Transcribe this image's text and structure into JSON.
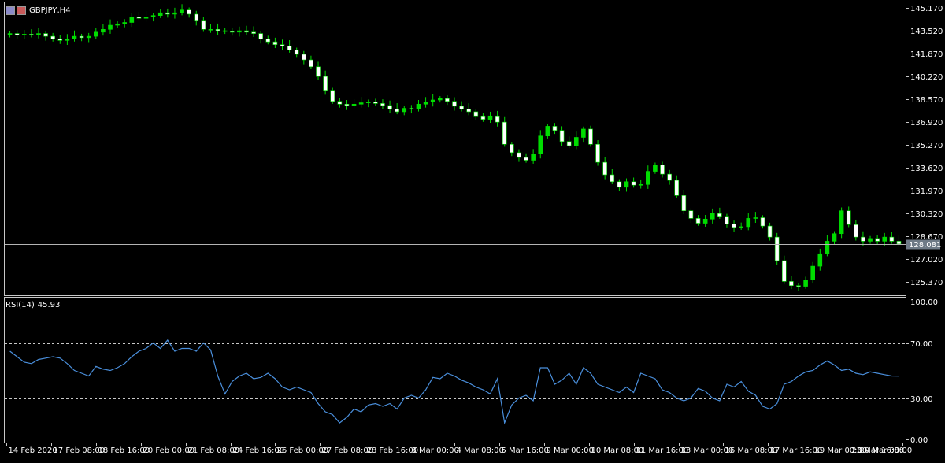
{
  "symbol": {
    "pair": "GBPJPY",
    "timeframe": "H4",
    "title": "GBPJPY,H4"
  },
  "icons": [
    "window-icon",
    "flag-icon"
  ],
  "colors": {
    "background": "#000000",
    "bull": "#00dd00",
    "bear": "#ffffff",
    "frame": "#c8c8c8",
    "rsi_line": "#4a8fdc",
    "current_price_tag": "#6e7a86"
  },
  "current_price": {
    "value": 128.081,
    "label": "128.081"
  },
  "price_axis": {
    "ticks": [
      "145.170",
      "143.520",
      "141.870",
      "140.220",
      "138.570",
      "136.920",
      "135.270",
      "133.620",
      "131.970",
      "130.320",
      "128.670",
      "127.020",
      "125.370"
    ],
    "range": [
      124.4,
      145.55
    ]
  },
  "rsi": {
    "label": "RSI(14)",
    "value_text": "45.93",
    "ticks": [
      "100.00",
      "70.00",
      "30.00",
      "0.00"
    ],
    "range": [
      0,
      100
    ],
    "levels": [
      70,
      30
    ]
  },
  "time_axis": [
    "14 Feb 2020",
    "17 Feb 08:00",
    "18 Feb 16:00",
    "20 Feb 00:00",
    "21 Feb 08:00",
    "24 Feb 16:00",
    "26 Feb 00:00",
    "27 Feb 08:00",
    "28 Feb 16:00",
    "3 Mar 00:00",
    "4 Mar 08:00",
    "5 Mar 16:00",
    "9 Mar 00:00",
    "10 Mar 08:00",
    "11 Mar 16:00",
    "13 Mar 00:00",
    "16 Mar 08:00",
    "17 Mar 16:00",
    "19 Mar 00:00",
    "20 Mar 08:00",
    "23 Mar 16:00"
  ],
  "chart_data": [
    {
      "type": "candlestick",
      "title": "GBPJPY,H4",
      "ylim": [
        124.4,
        145.55
      ],
      "x_labels": [
        "14 Feb 2020",
        "17 Feb 08:00",
        "18 Feb 16:00",
        "20 Feb 00:00",
        "21 Feb 08:00",
        "24 Feb 16:00",
        "26 Feb 00:00",
        "27 Feb 08:00",
        "28 Feb 16:00",
        "3 Mar 00:00",
        "4 Mar 08:00",
        "5 Mar 16:00",
        "9 Mar 00:00",
        "10 Mar 08:00",
        "11 Mar 16:00",
        "13 Mar 00:00",
        "16 Mar 08:00",
        "17 Mar 16:00",
        "19 Mar 00:00",
        "20 Mar 08:00",
        "23 Mar 16:00"
      ],
      "close": [
        143.3,
        143.2,
        143.25,
        143.2,
        143.3,
        143.1,
        142.9,
        142.8,
        142.9,
        143.1,
        143.0,
        143.1,
        143.4,
        143.6,
        143.9,
        144.0,
        144.1,
        144.5,
        144.4,
        144.5,
        144.6,
        144.8,
        144.7,
        144.8,
        145.0,
        144.7,
        144.2,
        143.6,
        143.6,
        143.5,
        143.45,
        143.4,
        143.5,
        143.4,
        143.3,
        142.9,
        142.7,
        142.5,
        142.4,
        142.1,
        141.8,
        141.4,
        140.9,
        140.2,
        139.2,
        138.4,
        138.2,
        138.1,
        138.2,
        138.3,
        138.35,
        138.25,
        138.1,
        137.85,
        137.65,
        137.9,
        137.85,
        138.2,
        138.35,
        138.5,
        138.6,
        138.4,
        138.05,
        137.85,
        137.65,
        137.35,
        137.1,
        137.35,
        136.9,
        135.3,
        134.7,
        134.35,
        134.15,
        134.6,
        135.9,
        136.6,
        136.3,
        135.5,
        135.2,
        135.8,
        136.4,
        135.3,
        134.0,
        133.1,
        132.6,
        132.2,
        132.6,
        132.35,
        132.4,
        133.35,
        133.8,
        133.15,
        132.7,
        131.6,
        130.5,
        129.95,
        129.6,
        129.9,
        130.3,
        130.1,
        129.55,
        129.3,
        129.35,
        129.95,
        130.0,
        129.4,
        128.6,
        126.9,
        125.4,
        125.1,
        125.05,
        125.5,
        126.5,
        127.4,
        128.3,
        128.85,
        130.5,
        129.5,
        128.6,
        128.3,
        128.5,
        128.3,
        128.6,
        128.3,
        128.1
      ],
      "rsi": [
        64,
        60,
        56,
        55,
        58,
        59,
        60,
        59,
        55,
        50,
        48,
        46,
        53,
        51,
        50,
        52,
        55,
        60,
        64,
        66,
        70,
        66,
        72,
        64,
        66,
        66,
        64,
        70,
        65,
        46,
        33,
        42,
        46,
        48,
        44,
        45,
        48,
        44,
        38,
        36,
        38,
        36,
        34,
        26,
        20,
        18,
        12,
        16,
        22,
        20,
        25,
        26,
        24,
        26,
        22,
        30,
        32,
        30,
        36,
        45,
        44,
        48,
        46,
        43,
        41,
        38,
        36,
        33,
        44,
        12,
        25,
        30,
        32,
        28,
        52,
        52,
        40,
        43,
        48,
        40,
        52,
        48,
        40,
        38,
        36,
        34,
        38,
        34,
        48,
        46,
        44,
        36,
        34,
        30,
        28,
        30,
        37,
        35,
        30,
        28,
        40,
        38,
        42,
        35,
        32,
        24,
        22,
        26,
        40,
        42,
        46,
        49,
        50,
        54,
        57,
        54,
        50,
        51,
        48,
        47,
        49,
        48,
        47,
        46,
        45.93
      ]
    }
  ]
}
